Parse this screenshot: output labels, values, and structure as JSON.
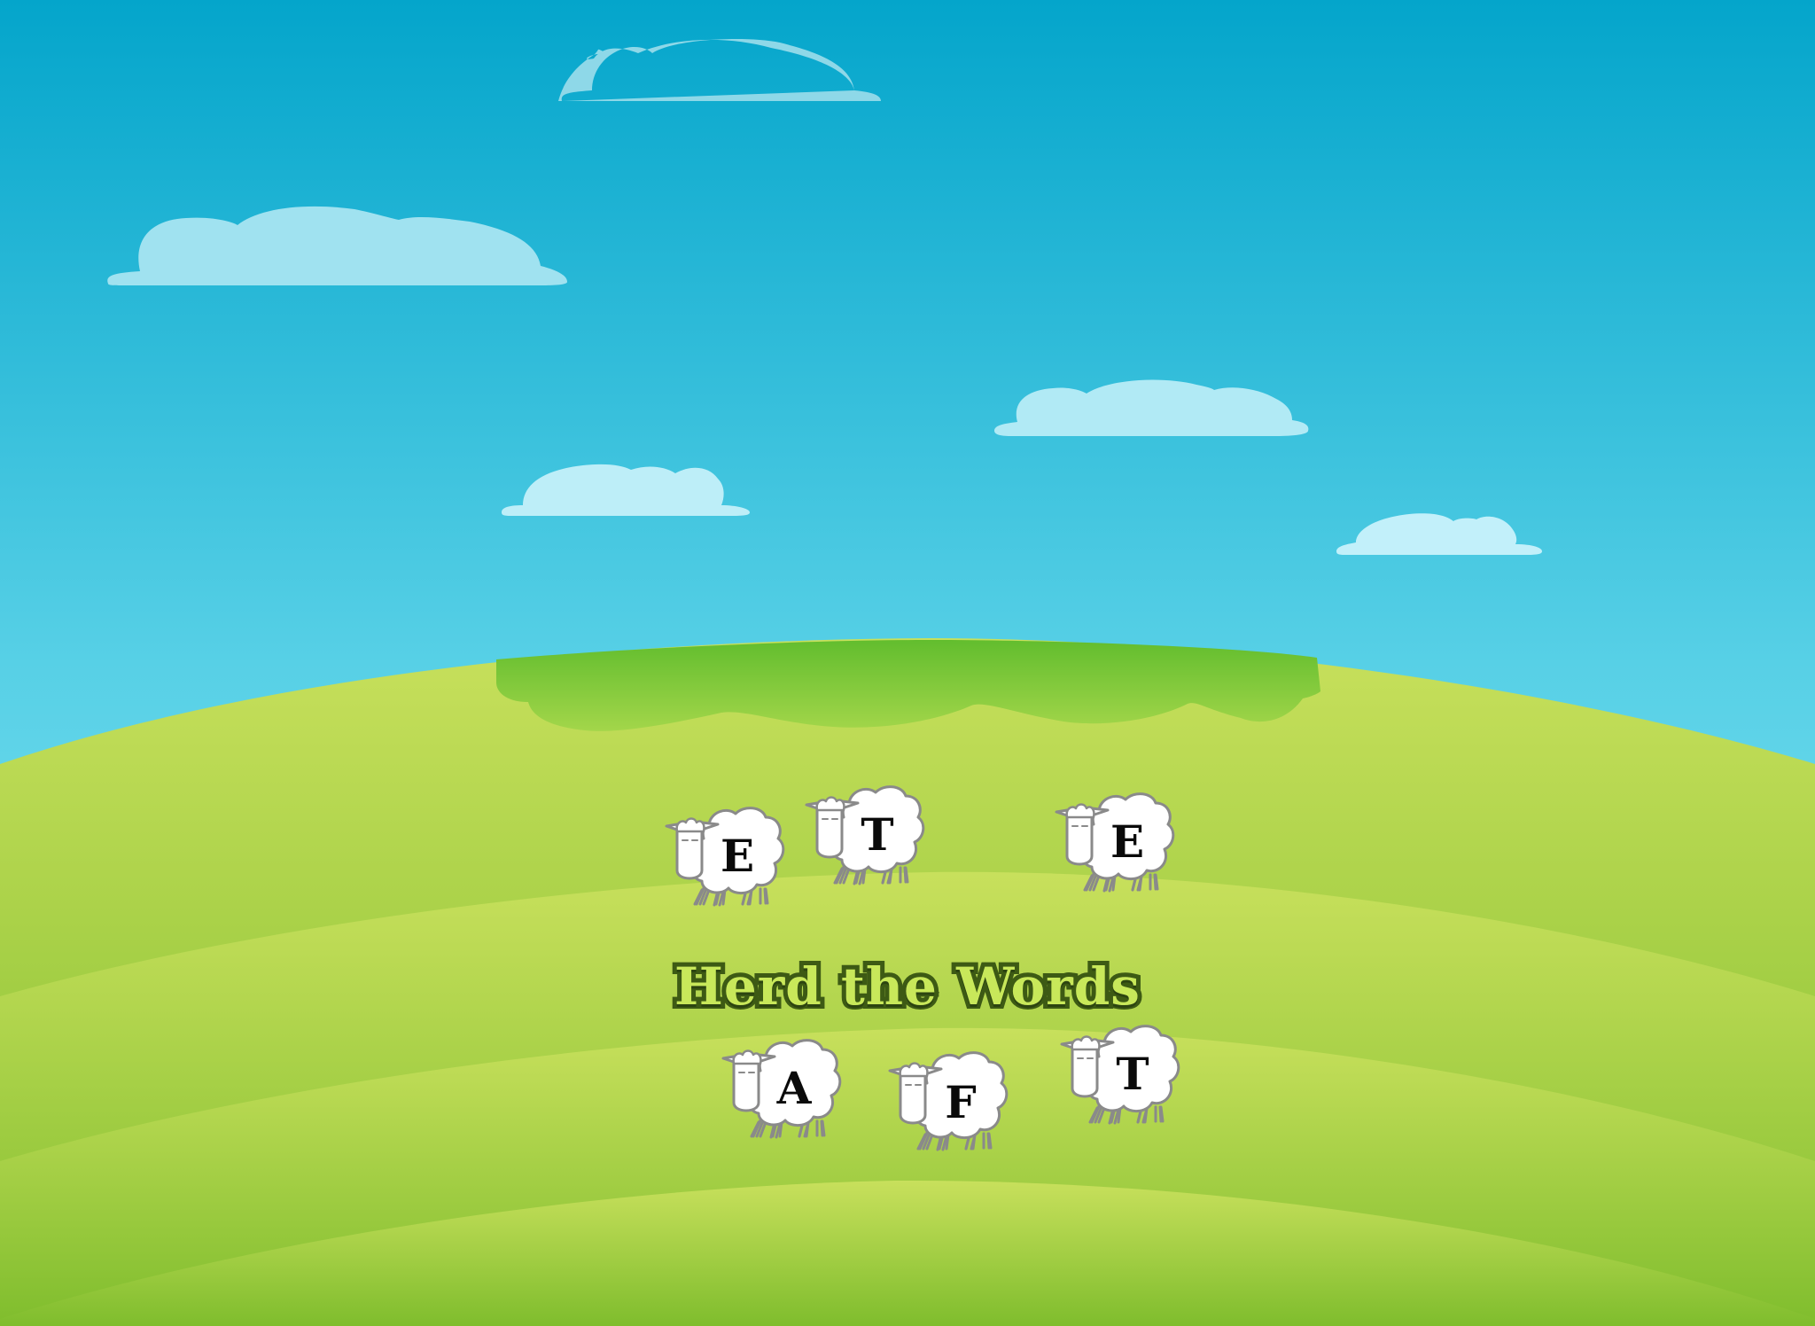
{
  "title": "Herd the Words",
  "colors": {
    "sky_top": "#04a5cb",
    "sky_bottom": "#85e8f4",
    "grass_light": "#c6e05a",
    "grass_dark": "#7ebf2c",
    "title_fill": "#c8e85a",
    "title_stroke": "#3d5a14"
  },
  "sheep": [
    {
      "letter": "E"
    },
    {
      "letter": "T"
    },
    {
      "letter": "E"
    },
    {
      "letter": "A"
    },
    {
      "letter": "F"
    },
    {
      "letter": "T"
    }
  ]
}
